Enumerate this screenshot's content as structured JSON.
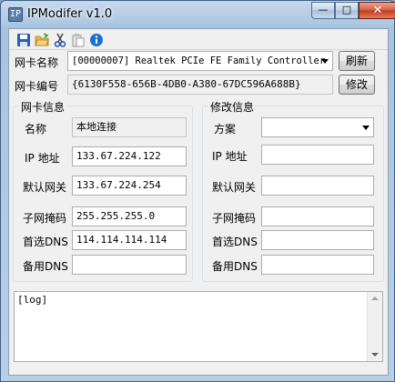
{
  "window": {
    "title": "IPModifer v1.0",
    "app_icon": "IP",
    "min": "—",
    "max": "□",
    "close": "✕"
  },
  "toolbar": [
    "save-icon",
    "open-folder-icon",
    "cut-icon",
    "paste-icon",
    "info-icon"
  ],
  "nic": {
    "name_label": "网卡名称",
    "name_value": "[00000007] Realtek PCIe FE Family Controller",
    "refresh": "刷新",
    "id_label": "网卡编号",
    "id_value": "{6130F558-656B-4DB0-A380-67DC596A688B}",
    "modify": "修改"
  },
  "info": {
    "title": "网卡信息",
    "name_label": "名称",
    "name_value": "本地连接",
    "ip_label": "IP 地址",
    "ip_value": "133.67.224.122",
    "gw_label": "默认网关",
    "gw_value": "133.67.224.254",
    "mask_label": "子网掩码",
    "mask_value": "255.255.255.0",
    "dns1_label": "首选DNS",
    "dns1_value": "114.114.114.114",
    "dns2_label": "备用DNS",
    "dns2_value": ""
  },
  "edit": {
    "title": "修改信息",
    "scheme_label": "方案",
    "scheme_value": "",
    "ip_label": "IP 地址",
    "gw_label": "默认网关",
    "mask_label": "子网掩码",
    "dns1_label": "首选DNS",
    "dns2_label": "备用DNS"
  },
  "log": {
    "text": "[log]"
  }
}
